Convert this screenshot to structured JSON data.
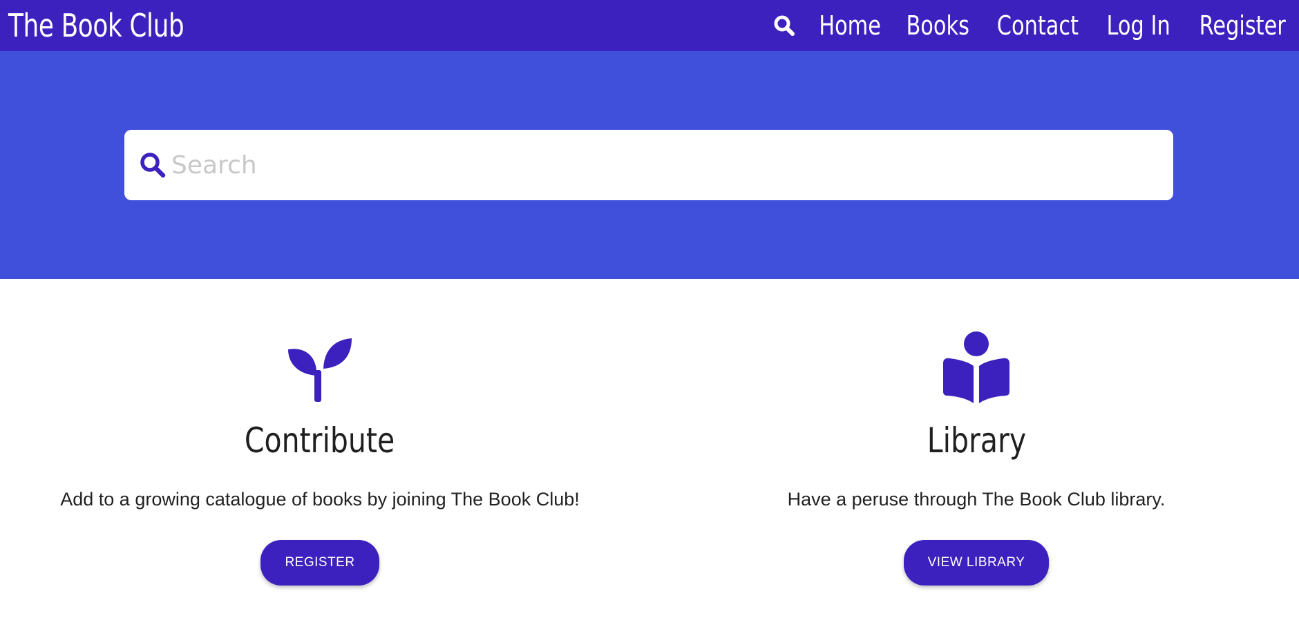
{
  "colors": {
    "navbar": "#3d21bf",
    "hero": "#4150da",
    "accent": "#3d21bf",
    "placeholder": "#c8c8c8"
  },
  "navbar": {
    "brand": "The Book Club",
    "search_icon": "search-icon",
    "links": [
      "Home",
      "Books",
      "Contact",
      "Log In",
      "Register"
    ]
  },
  "search": {
    "icon": "search-icon",
    "placeholder": "Search",
    "value": ""
  },
  "cards": [
    {
      "icon": "seedling-icon",
      "title": "Contribute",
      "text": "Add to a growing catalogue of books by joining The Book Club!",
      "button": "REGISTER"
    },
    {
      "icon": "book-reader-icon",
      "title": "Library",
      "text": "Have a peruse through The Book Club library.",
      "button": "VIEW LIBRARY"
    }
  ]
}
